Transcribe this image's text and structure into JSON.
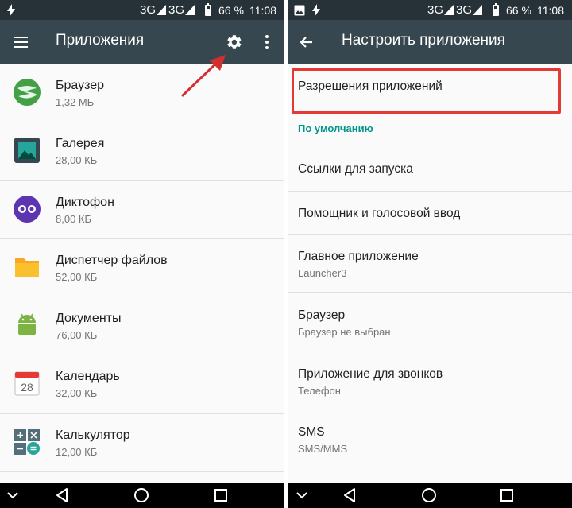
{
  "colors": {
    "status_bar": "#263238",
    "app_bar": "#37474f",
    "accent": "#009688",
    "highlight": "#e53935",
    "arrow": "#d32f2f"
  },
  "status_bar": {
    "network_1": "3G",
    "network_2": "3G",
    "battery": "66 %",
    "time": "11:08"
  },
  "left_screen": {
    "title": "Приложения",
    "icons": [
      "menu-icon",
      "gear-icon",
      "more-vert-icon"
    ],
    "apps": [
      {
        "name": "Браузер",
        "size": "1,32 МБ",
        "icon": "browser-icon"
      },
      {
        "name": "Галерея",
        "size": "28,00 КБ",
        "icon": "gallery-icon"
      },
      {
        "name": "Диктофон",
        "size": "8,00 КБ",
        "icon": "recorder-icon"
      },
      {
        "name": "Диспетчер файлов",
        "size": "52,00 КБ",
        "icon": "folder-icon"
      },
      {
        "name": "Документы",
        "size": "76,00 КБ",
        "icon": "android-icon"
      },
      {
        "name": "Календарь",
        "size": "32,00 КБ",
        "icon": "calendar-icon",
        "calendar_day": "28"
      },
      {
        "name": "Калькулятор",
        "size": "12,00 КБ",
        "icon": "calculator-icon"
      }
    ]
  },
  "right_screen": {
    "title": "Настроить приложения",
    "permissions": "Разрешения приложений",
    "section_default": "По умолчанию",
    "items": [
      {
        "title": "Ссылки для запуска"
      },
      {
        "title": "Помощник и голосовой ввод"
      },
      {
        "title": "Главное приложение",
        "subtitle": "Launcher3"
      },
      {
        "title": "Браузер",
        "subtitle": "Браузер не выбран"
      },
      {
        "title": "Приложение для звонков",
        "subtitle": "Телефон"
      },
      {
        "title": "SMS",
        "subtitle": "SMS/MMS"
      }
    ]
  },
  "nav_bar": [
    "collapse-icon",
    "back-icon",
    "home-icon",
    "recents-icon"
  ]
}
